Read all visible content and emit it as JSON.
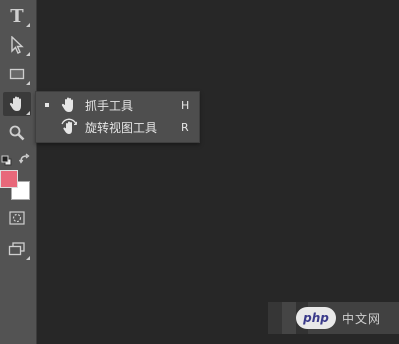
{
  "toolbar": {
    "text_tool_glyph": "T",
    "tools": [
      {
        "icon": "type-tool-icon"
      },
      {
        "icon": "path-selection-icon"
      },
      {
        "icon": "rectangle-tool-icon"
      },
      {
        "icon": "hand-tool-icon",
        "active": true
      },
      {
        "icon": "zoom-tool-icon"
      },
      {
        "icon": "default-colors-icon"
      },
      {
        "icon": "swap-colors-icon"
      },
      {
        "icon": "quick-mask-icon"
      },
      {
        "icon": "screen-mode-icon"
      }
    ],
    "foreground_color": "#e8687a",
    "background_color": "#ffffff"
  },
  "flyout": {
    "items": [
      {
        "label": "抓手工具",
        "shortcut": "H",
        "icon": "hand-icon",
        "selected": true
      },
      {
        "label": "旋转视图工具",
        "shortcut": "R",
        "icon": "rotate-view-icon",
        "selected": false
      }
    ]
  },
  "watermark": {
    "badge": "php",
    "text": "中文网"
  }
}
